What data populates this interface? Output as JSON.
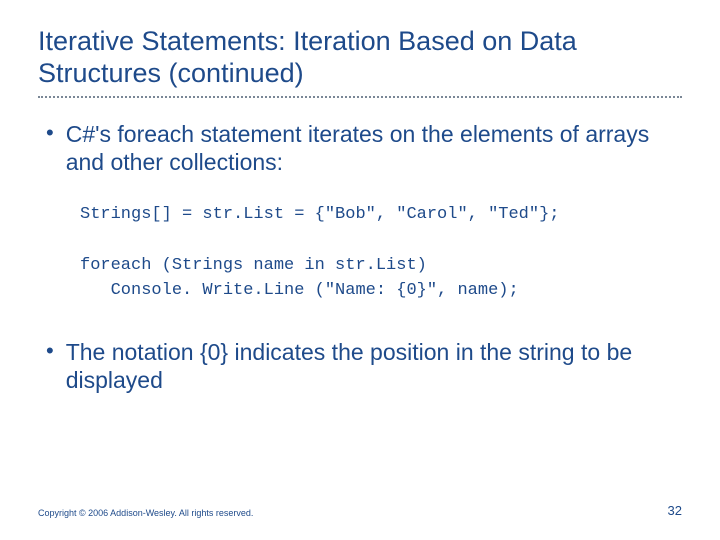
{
  "title": "Iterative Statements: Iteration Based on Data Structures (continued)",
  "bullets": [
    "C#'s foreach statement iterates on the elements of arrays and other collections:",
    "The notation {0} indicates the position in the string to be displayed"
  ],
  "code": "Strings[] = str.List = {\"Bob\", \"Carol\", \"Ted\"};\n\nforeach (Strings name in str.List)\n   Console. Write.Line (\"Name: {0}\", name);",
  "copyright": "Copyright © 2006 Addison-Wesley. All rights reserved.",
  "page": "32"
}
